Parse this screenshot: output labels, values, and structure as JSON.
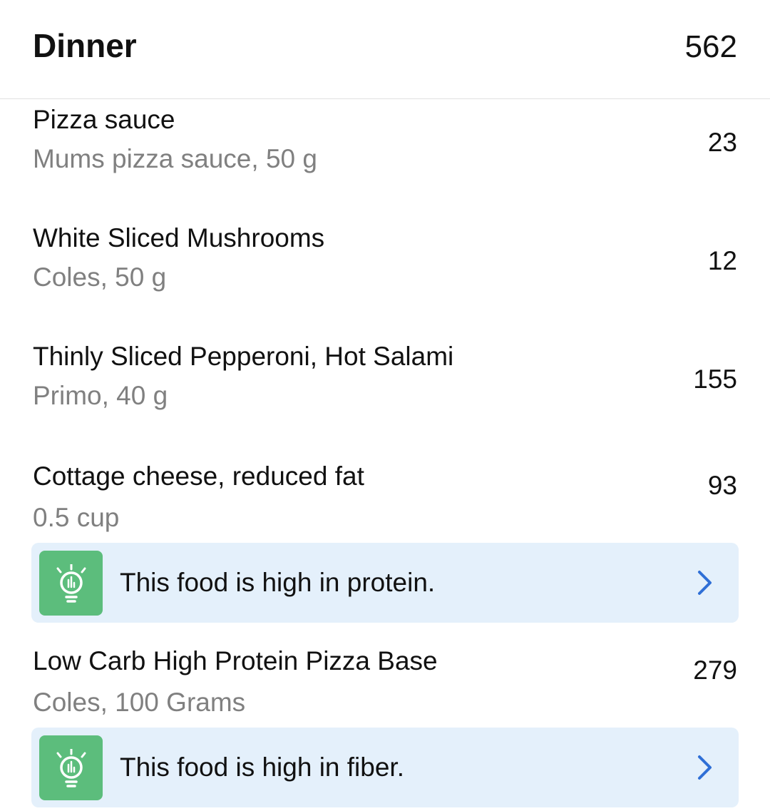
{
  "header": {
    "title": "Dinner",
    "total": "562"
  },
  "items": [
    {
      "name": "Pizza sauce",
      "detail": "Mums pizza sauce, 50 g",
      "calories": "23"
    },
    {
      "name": "White Sliced Mushrooms",
      "detail": "Coles, 50 g",
      "calories": "12"
    },
    {
      "name": "Thinly Sliced Pepperoni, Hot Salami",
      "detail": "Primo, 40 g",
      "calories": "155"
    },
    {
      "name": "Cottage cheese, reduced fat",
      "detail": "0.5 cup",
      "calories": "93",
      "insight": {
        "text": "This food is high in protein.",
        "icon": "lightbulb-icon"
      }
    },
    {
      "name": "Low Carb High Protein Pizza Base",
      "detail": "Coles, 100 Grams",
      "calories": "279",
      "insight": {
        "text": "This food is high in fiber.",
        "icon": "lightbulb-icon"
      }
    }
  ],
  "colors": {
    "insight_background": "#e4f0fb",
    "insight_icon_background": "#5cbd7c",
    "chevron": "#2f6fd6",
    "detail_text": "#808080"
  }
}
